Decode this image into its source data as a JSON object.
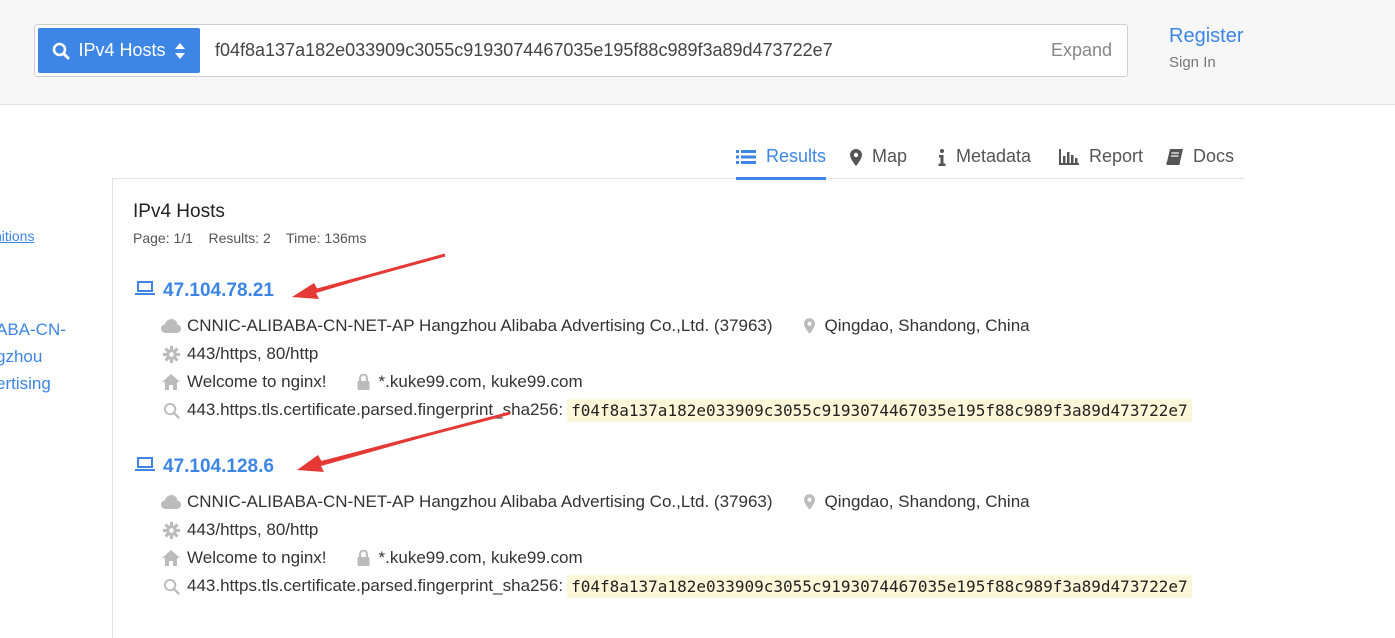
{
  "header": {
    "search_type": "IPv4 Hosts",
    "query": "f04f8a137a182e033909c3055c9193074467035e195f88c989f3a89d473722e7",
    "expand_label": "Expand",
    "register_label": "Register",
    "signin_label": "Sign In"
  },
  "tabs": [
    {
      "label": "Results",
      "icon": "list-icon",
      "active": true
    },
    {
      "label": "Map",
      "icon": "map-marker-icon"
    },
    {
      "label": "Metadata",
      "icon": "info-icon"
    },
    {
      "label": "Report",
      "icon": "bar-chart-icon"
    },
    {
      "label": "Docs",
      "icon": "book-icon"
    }
  ],
  "sidebar": {
    "definitions_link": "nitions",
    "facet_lines": [
      "ABA-CN-",
      "gzhou",
      "ertising"
    ]
  },
  "results": {
    "title": "IPv4 Hosts",
    "meta": "Page: 1/1    Results: 2    Time: 136ms",
    "hosts": [
      {
        "ip": "47.104.78.21",
        "asn": "CNNIC-ALIBABA-CN-NET-AP Hangzhou Alibaba Advertising Co.,Ltd. (37963)",
        "location": "Qingdao, Shandong, China",
        "services": "443/https, 80/http",
        "title": "Welcome to nginx!",
        "cert_names": "*.kuke99.com, kuke99.com",
        "match_field": "443.https.tls.certificate.parsed.fingerprint_sha256:",
        "match_value": "f04f8a137a182e033909c3055c9193074467035e195f88c989f3a89d473722e7"
      },
      {
        "ip": "47.104.128.6",
        "asn": "CNNIC-ALIBABA-CN-NET-AP Hangzhou Alibaba Advertising Co.,Ltd. (37963)",
        "location": "Qingdao, Shandong, China",
        "services": "443/https, 80/http",
        "title": "Welcome to nginx!",
        "cert_names": "*.kuke99.com, kuke99.com",
        "match_field": "443.https.tls.certificate.parsed.fingerprint_sha256:",
        "match_value": "f04f8a137a182e033909c3055c9193074467035e195f88c989f3a89d473722e7"
      }
    ]
  },
  "colors": {
    "accent": "#3d86e6",
    "annotation_arrow": "#e53935",
    "highlight": "#fdf6d8"
  }
}
